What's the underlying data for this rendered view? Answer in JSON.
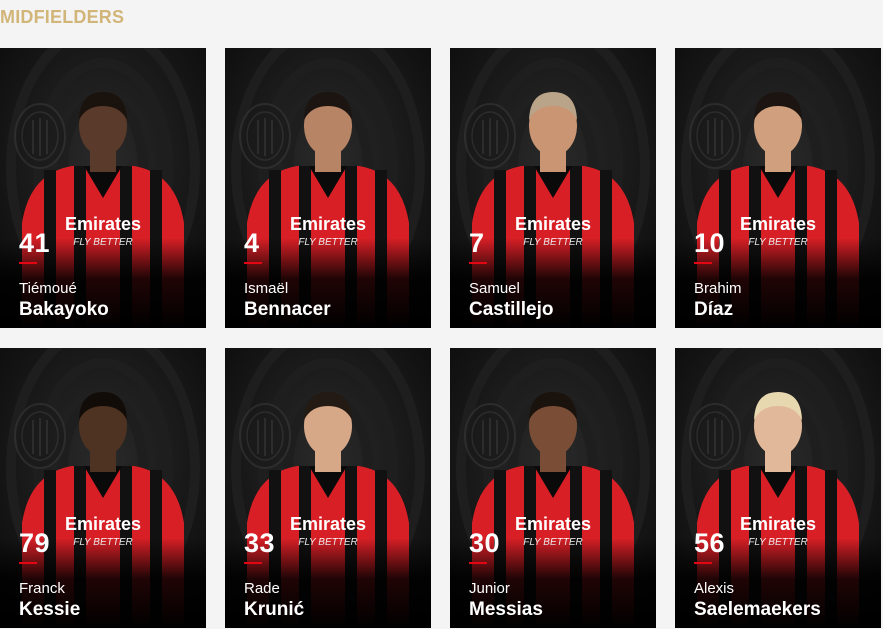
{
  "section": {
    "title": "MIDFIELDERS"
  },
  "players": [
    {
      "number": "41",
      "first": "Tiémoué",
      "last": "Bakayoko",
      "skin": "#5a3a2a",
      "hair": "#1a120c"
    },
    {
      "number": "4",
      "first": "Ismaël",
      "last": "Bennacer",
      "skin": "#b88466",
      "hair": "#1b1410"
    },
    {
      "number": "7",
      "first": "Samuel",
      "last": "Castillejo",
      "skin": "#c99573",
      "hair": "#b9a48a"
    },
    {
      "number": "10",
      "first": "Brahim",
      "last": "Díaz",
      "skin": "#d0a07e",
      "hair": "#1c1410"
    },
    {
      "number": "79",
      "first": "Franck",
      "last": "Kessie",
      "skin": "#4e3222",
      "hair": "#120c08"
    },
    {
      "number": "33",
      "first": "Rade",
      "last": "Krunić",
      "skin": "#d6a888",
      "hair": "#241a14"
    },
    {
      "number": "30",
      "first": "Junior",
      "last": "Messias",
      "skin": "#7a4e36",
      "hair": "#1a120c"
    },
    {
      "number": "56",
      "first": "Alexis",
      "last": "Saelemaekers",
      "skin": "#e2b89a",
      "hair": "#e8d8b0"
    }
  ],
  "colors": {
    "accent": "#d2b578",
    "red": "#e30613",
    "kit_red": "#d81f26",
    "kit_black": "#111111"
  },
  "kit": {
    "sponsor": "Emirates",
    "tagline": "FLY BETTER"
  }
}
